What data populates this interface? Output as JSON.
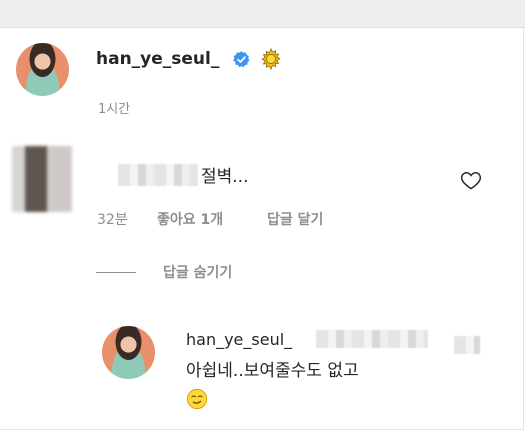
{
  "post": {
    "username": "han_ye_seul_",
    "time": "1시간",
    "verified_icon": "verified-badge-icon",
    "emoji_icon": "sun-emoji-icon"
  },
  "comment": {
    "text": "절벽...",
    "time": "32분",
    "likes": "좋아요 1개",
    "reply_action": "답글 달기"
  },
  "hide_replies": "답글 숨기기",
  "reply": {
    "username": "han_ye_seul_",
    "text": "아쉽네..보여줄수도 없고",
    "emoji_icon": "smirk-emoji-icon"
  },
  "colors": {
    "text": "#262626",
    "secondary": "#8e8e8e",
    "verified": "#3897f0"
  }
}
